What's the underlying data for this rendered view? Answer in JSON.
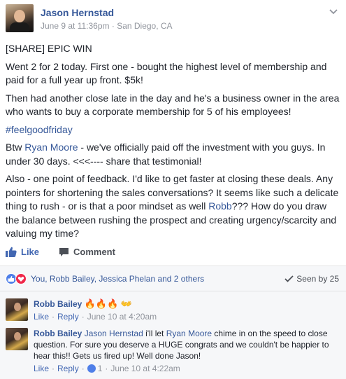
{
  "post": {
    "author": "Jason Hernstad",
    "timestamp": "June 9 at 11:36pm",
    "location": "San Diego, CA",
    "meta_sep": " · ",
    "paragraphs": {
      "p1": "[SHARE] EPIC WIN",
      "p2": "Went 2 for 2 today. First one - bought the highest level of membership and paid for a full year up front. $5k!",
      "p3": "Then had another close late in the day and he's a business owner in the area who wants to buy a corporate membership for 5 of his employees!",
      "p4": "#feelgoodfriday",
      "p5_pre": "Btw ",
      "p5_link": "Ryan Moore",
      "p5_post": " - we've officially paid off the investment with you guys. In under 30 days. <<<---- share that testimonial!",
      "p6_pre": "Also - one point of feedback. I'd like to get faster at closing these deals. Any pointers for shortening the sales conversations? It seems like such a delicate thing to rush - or is that a poor mindset as well ",
      "p6_link": "Robb",
      "p6_post": "??? How do you draw the balance between rushing the prospect and creating urgency/scarcity and valuing my time?"
    }
  },
  "actions": {
    "like_label": "Like",
    "comment_label": "Comment"
  },
  "reactions": {
    "summary": "You, Robb Bailey, Jessica Phelan and 2 others",
    "seen_label": "Seen by 25",
    "icons": [
      "like-reaction-icon",
      "love-reaction-icon"
    ]
  },
  "comments": [
    {
      "author": "Robb Bailey",
      "text": "",
      "emoji": "🔥🔥🔥 👐",
      "like_label": "Like",
      "reply_label": "Reply",
      "time": "June 10 at 4:20am",
      "likes": ""
    },
    {
      "author": "Robb Bailey",
      "mention1": "Jason Hernstad",
      "text_mid": " i'll let ",
      "mention2": "Ryan Moore",
      "text_post": " chime in on the speed to close question. For sure you deserve a HUGE congrats and we couldn't be happier to hear this!! Gets us fired up! Well done Jason!",
      "like_label": "Like",
      "reply_label": "Reply",
      "likes": "1",
      "time": "June 10 at 4:22am"
    }
  ],
  "colors": {
    "link": "#365899",
    "like_blue": "#4267b2",
    "meta_gray": "#90949c",
    "comment_bg": "#f6f7f9"
  }
}
